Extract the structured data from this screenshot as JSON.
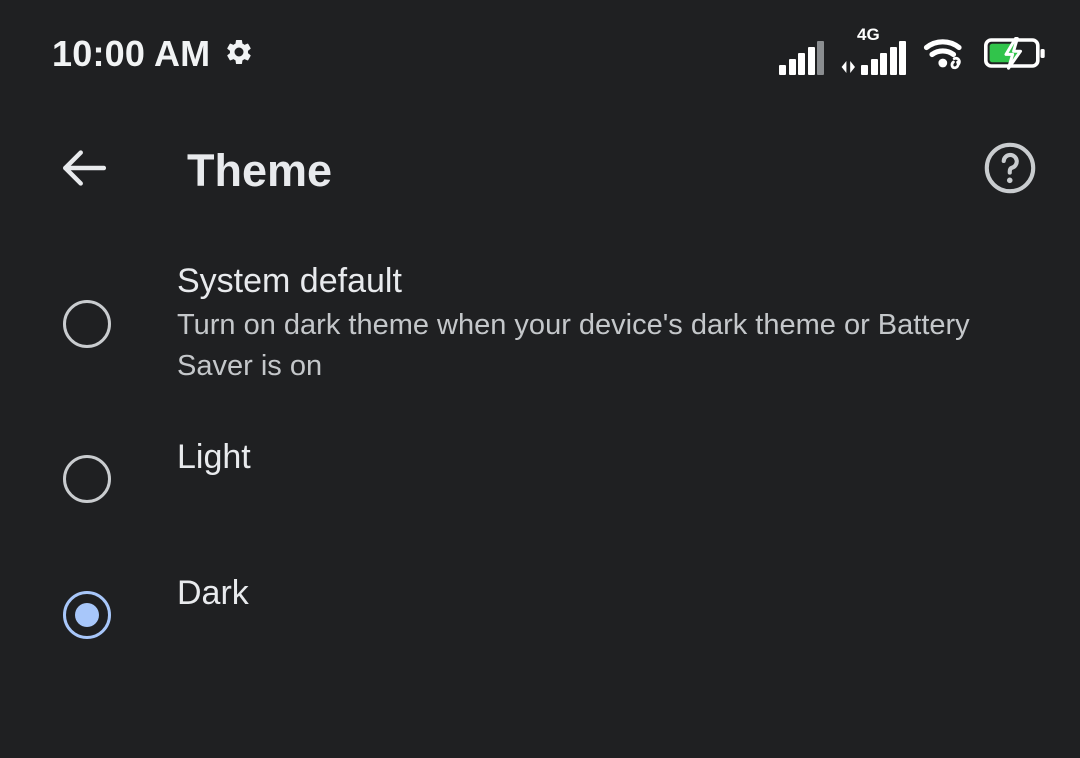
{
  "status_bar": {
    "time": "10:00 AM",
    "settings_icon": "gear-icon",
    "signal_icon": "cellular-signal-icon",
    "network_type": "4G",
    "signal2_icon": "cellular-signal-4g-icon",
    "data_arrows_icon": "data-transfer-arrows-icon",
    "wifi_icon": "wifi-connected-icon",
    "battery_icon": "battery-charging-icon",
    "battery_color": "#31c44b"
  },
  "app_bar": {
    "back_icon": "arrow-back-icon",
    "title": "Theme",
    "help_icon": "help-circle-icon"
  },
  "theme_options": {
    "selected": "Dark",
    "accent_color": "#a8c7fa",
    "items": [
      {
        "id": "system-default",
        "label": "System default",
        "description": "Turn on dark theme when your device's dark theme or Battery Saver is on",
        "selected": false
      },
      {
        "id": "light",
        "label": "Light",
        "description": "",
        "selected": false
      },
      {
        "id": "dark",
        "label": "Dark",
        "description": "",
        "selected": true
      }
    ]
  },
  "colors": {
    "background": "#1f2022",
    "primary_text": "#e8eaed",
    "secondary_text": "#c4c7ca",
    "accent": "#a8c7fa"
  }
}
